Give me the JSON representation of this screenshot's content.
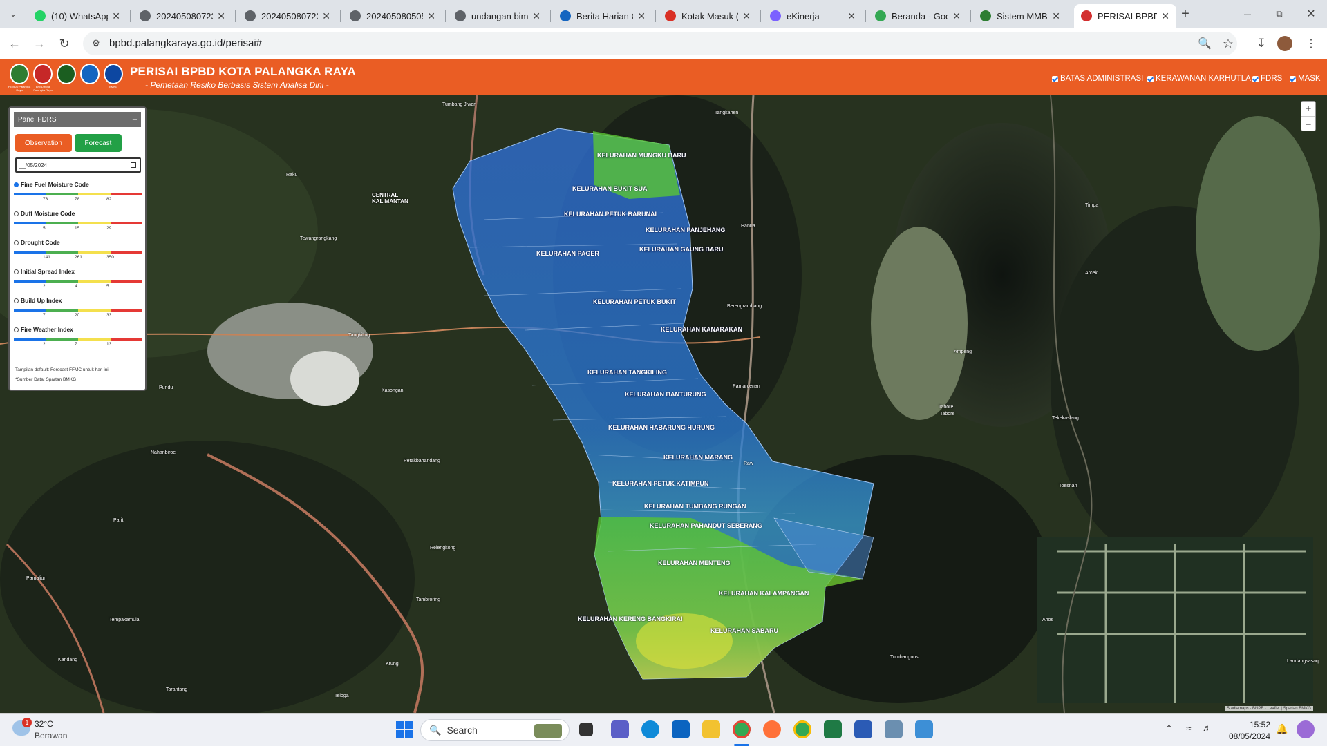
{
  "browser": {
    "tabs": [
      {
        "label": "(10) WhatsApp",
        "color": "#25d366"
      },
      {
        "label": "202405080723",
        "color": "#5f6368"
      },
      {
        "label": "202405080723",
        "color": "#5f6368"
      },
      {
        "label": "202405080505",
        "color": "#5f6368"
      },
      {
        "label": "undangan bimt",
        "color": "#5f6368"
      },
      {
        "label": "Berita Harian C",
        "color": "#1565c0"
      },
      {
        "label": "Kotak Masuk (1",
        "color": "#d93025"
      },
      {
        "label": "eKinerja",
        "color": "#7b61ff"
      },
      {
        "label": "Beranda - Goo",
        "color": "#34a853"
      },
      {
        "label": "Sistem MMBC",
        "color": "#2e7d32"
      },
      {
        "label": "PERISAI BPBD",
        "color": "#d32f2f"
      }
    ],
    "url": "bpbd.palangkaraya.go.id/perisai#"
  },
  "site": {
    "title": "PERISAI BPBD KOTA PALANGKA RAYA",
    "subtitle": "- Pemetaan Resiko Berbasis Sistem Analisa Dini -",
    "logos": [
      {
        "caption": "PEMKO Palangka Raya",
        "color": "#2e7d32"
      },
      {
        "caption": "BPBD Kota Palangka Raya",
        "color": "#c62828"
      },
      {
        "caption": "",
        "color": "#1b5e20"
      },
      {
        "caption": "",
        "color": "#1565c0"
      },
      {
        "caption": "BMKG",
        "color": "#0d47a1"
      }
    ],
    "layers": [
      "BATAS ADMINISTRASI",
      "KERAWANAN KARHUTLA",
      "FDRS",
      "MASK"
    ]
  },
  "panel": {
    "title": "Panel FDRS",
    "observation": "Observation",
    "forecast": "Forecast",
    "date": "__/05/2024",
    "indices": [
      {
        "name": "Fine Fuel Moisture Code",
        "ticks": [
          "73",
          "78",
          "82"
        ],
        "selected": true
      },
      {
        "name": "Duff Moisture Code",
        "ticks": [
          "5",
          "15",
          "29"
        ],
        "selected": false
      },
      {
        "name": "Drought Code",
        "ticks": [
          "141",
          "261",
          "350"
        ],
        "selected": false
      },
      {
        "name": "Initial Spread Index",
        "ticks": [
          "2",
          "4",
          "5"
        ],
        "selected": false
      },
      {
        "name": "Build Up Index",
        "ticks": [
          "7",
          "20",
          "33"
        ],
        "selected": false
      },
      {
        "name": "Fire Weather Index",
        "ticks": [
          "2",
          "7",
          "13"
        ],
        "selected": false
      }
    ],
    "note1": "Tampilan default: Forecast FFMC untuk hari ini",
    "note2": "*Sumber Data: Spartan BMKG"
  },
  "map": {
    "kelurahan": [
      "KELURAHAN MUNGKU BARU",
      "KELURAHAN BUKIT SUA",
      "KELURAHAN PETUK BARUNAI",
      "KELURAHAN PANJEHANG",
      "KELURAHAN GAUNG BARU",
      "KELURAHAN PAGER",
      "KELURAHAN PETUK BUKIT",
      "KELURAHAN KANARAKAN",
      "KELURAHAN TANGKILING",
      "KELURAHAN BANTURUNG",
      "KELURAHAN HABARUNG HURUNG",
      "KELURAHAN MARANG",
      "KELURAHAN PETUK KATIMPUN",
      "KELURAHAN TUMBANG RUNGAN",
      "KELURAHAN PAHANDUT SEBERANG",
      "KELURAHAN MENTENG",
      "KELURAHAN KALAMPANGAN",
      "KELURAHAN KERENG BANGKIRAI",
      "KELURAHAN SABARU"
    ],
    "places": [
      "Tumbang Jiwan",
      "Tangkahen",
      "Raku",
      "CENTRAL KALIMANTAN",
      "Tewangrangkang",
      "Hanua",
      "Timpa",
      "Arcek",
      "Berengrambang",
      "Tangkiling",
      "Ampeng",
      "Pamarcenan",
      "Pundu",
      "Kasongan",
      "Tabore",
      "Tabore",
      "Tekekaslang",
      "Nahanbiroe",
      "Petakbahandang",
      "Raw",
      "Toesnan",
      "Parit",
      "Reiengkong",
      "Tambroring",
      "Pamaliun",
      "Tempakamula",
      "Kandang",
      "Krung",
      "Tarantang",
      "Teloga",
      "Tumbangnus",
      "Ahos",
      "Landangsasaq"
    ],
    "attribution": "Stadiamaps · BNPB · Leaflet | Spartan BMKG",
    "zoom_in": "+",
    "zoom_out": "−"
  },
  "taskbar": {
    "temp": "32°C",
    "weather": "Berawan",
    "search": "Search",
    "time": "15:52",
    "date": "08/05/2024"
  }
}
